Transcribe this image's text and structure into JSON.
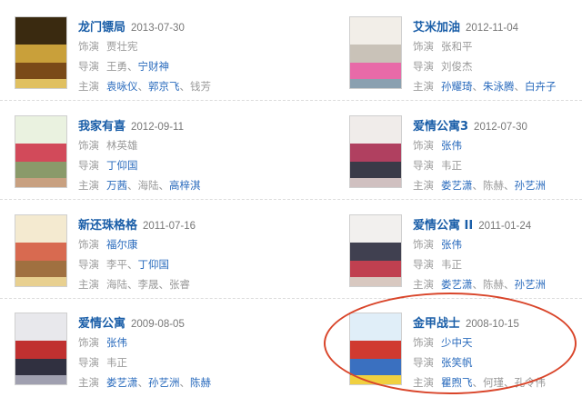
{
  "labels": {
    "voice": "饰演",
    "director": "导演",
    "starring": "主演"
  },
  "movies": [
    {
      "title": "龙门镖局",
      "date": "2013-07-30",
      "voice": [
        {
          "name": "贾壮宪",
          "link": false
        }
      ],
      "director": [
        {
          "name": "王勇",
          "link": false
        },
        {
          "name": "宁财神",
          "link": true
        }
      ],
      "starring": [
        {
          "name": "袁咏仪",
          "link": true
        },
        {
          "name": "郭京飞",
          "link": true
        },
        {
          "name": "钱芳",
          "link": false
        }
      ],
      "poster_colors": [
        "#3a2a10",
        "#c9a03a",
        "#7a4a18",
        "#e0c060"
      ]
    },
    {
      "title": "艾米加油",
      "date": "2012-11-04",
      "voice": [
        {
          "name": "张和平",
          "link": false
        }
      ],
      "director": [
        {
          "name": "刘俊杰",
          "link": false
        }
      ],
      "starring": [
        {
          "name": "孙耀琦",
          "link": true
        },
        {
          "name": "朱泳腾",
          "link": true
        },
        {
          "name": "白卉子",
          "link": true
        }
      ],
      "poster_colors": [
        "#f2eee8",
        "#c9c2b8",
        "#e86aa8",
        "#8aa0b0"
      ]
    },
    {
      "title": "我家有喜",
      "date": "2012-09-11",
      "voice": [
        {
          "name": "林英雄",
          "link": false
        }
      ],
      "director": [
        {
          "name": "丁仰国",
          "link": true
        }
      ],
      "starring": [
        {
          "name": "万茜",
          "link": true
        },
        {
          "name": "海陆",
          "link": false
        },
        {
          "name": "高梓淇",
          "link": true
        }
      ],
      "poster_colors": [
        "#eaf2e0",
        "#d24a5a",
        "#8a9a6a",
        "#c8a080"
      ]
    },
    {
      "title": "爱情公寓3",
      "date": "2012-07-30",
      "voice": [
        {
          "name": "张伟",
          "link": true
        }
      ],
      "director": [
        {
          "name": "韦正",
          "link": false
        }
      ],
      "starring": [
        {
          "name": "娄艺潇",
          "link": true
        },
        {
          "name": "陈赫",
          "link": false
        },
        {
          "name": "孙艺洲",
          "link": true
        }
      ],
      "poster_colors": [
        "#f0ecea",
        "#b04060",
        "#3a3a48",
        "#d0c0c0"
      ]
    },
    {
      "title": "新还珠格格",
      "date": "2011-07-16",
      "voice": [
        {
          "name": "福尔康",
          "link": true
        }
      ],
      "director": [
        {
          "name": "李平",
          "link": false
        },
        {
          "name": "丁仰国",
          "link": true
        }
      ],
      "starring": [
        {
          "name": "海陆",
          "link": false
        },
        {
          "name": "李晟",
          "link": false
        },
        {
          "name": "张睿",
          "link": false
        }
      ],
      "poster_colors": [
        "#f4ead0",
        "#d86a50",
        "#a07040",
        "#e8d090"
      ]
    },
    {
      "title": "爱情公寓 II",
      "date": "2011-01-24",
      "voice": [
        {
          "name": "张伟",
          "link": true
        }
      ],
      "director": [
        {
          "name": "韦正",
          "link": false
        }
      ],
      "starring": [
        {
          "name": "娄艺潇",
          "link": true
        },
        {
          "name": "陈赫",
          "link": false
        },
        {
          "name": "孙艺洲",
          "link": true
        }
      ],
      "poster_colors": [
        "#f2f0ee",
        "#404050",
        "#c04050",
        "#d8c8c0"
      ]
    },
    {
      "title": "爱情公寓",
      "date": "2009-08-05",
      "voice": [
        {
          "name": "张伟",
          "link": true
        }
      ],
      "director": [
        {
          "name": "韦正",
          "link": false
        }
      ],
      "starring": [
        {
          "name": "娄艺潇",
          "link": true
        },
        {
          "name": "孙艺洲",
          "link": true
        },
        {
          "name": "陈赫",
          "link": true
        }
      ],
      "poster_colors": [
        "#e8e8ec",
        "#c03030",
        "#303040",
        "#a0a0b0"
      ]
    },
    {
      "title": "金甲战士",
      "date": "2008-10-15",
      "voice": [
        {
          "name": "少中天",
          "link": true
        }
      ],
      "director": [
        {
          "name": "张笑帆",
          "link": true
        }
      ],
      "starring": [
        {
          "name": "瞿煦飞",
          "link": true
        },
        {
          "name": "何瑾",
          "link": false
        },
        {
          "name": "孔令伟",
          "link": false
        }
      ],
      "poster_colors": [
        "#e0eef8",
        "#d03a30",
        "#3a70c0",
        "#f0d040"
      ]
    }
  ],
  "highlight_color": "#d9452a"
}
